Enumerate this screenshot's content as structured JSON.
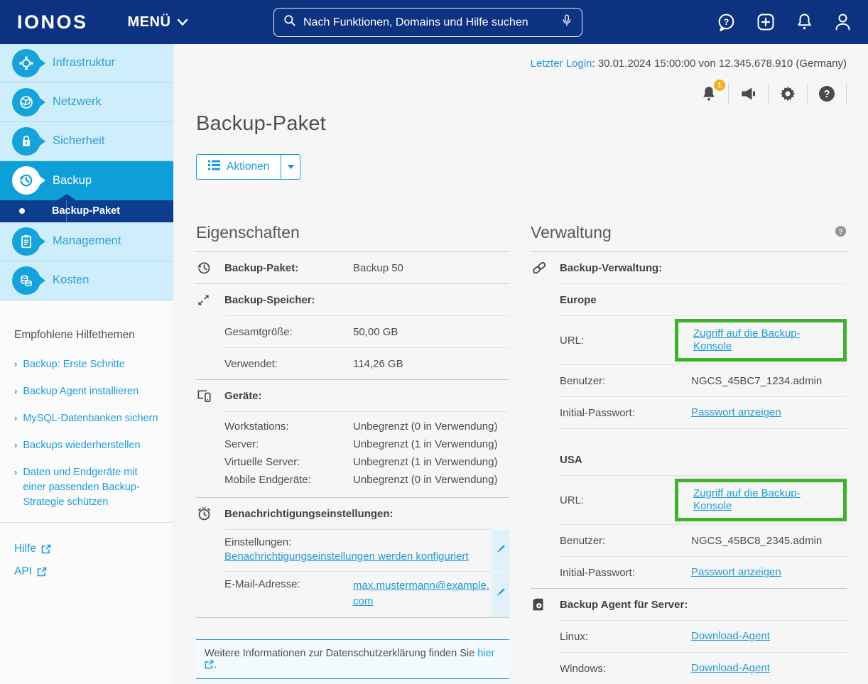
{
  "colors": {
    "accent_blue": "#1d9bd7",
    "header_navy": "#0d3380",
    "sidebar_blue": "#16a3db",
    "active_item_blue": "#0f9fd8",
    "subitem_navy": "#0d3d8e",
    "highlight_green": "#3cb32a",
    "badge_yellow": "#f2b21d"
  },
  "header": {
    "logo": "IONOS",
    "menu_label": "MENÜ",
    "search_placeholder": "Nach Funktionen, Domains und Hilfe suchen"
  },
  "sidebar": {
    "items": [
      {
        "label": "Infrastruktur"
      },
      {
        "label": "Netzwerk"
      },
      {
        "label": "Sicherheit"
      },
      {
        "label": "Backup"
      },
      {
        "label": "Management"
      },
      {
        "label": "Kosten"
      }
    ],
    "active_item": "Backup",
    "subitem": {
      "label": "Backup-Paket"
    },
    "help_section": {
      "title": "Empfohlene Hilfethemen",
      "links": [
        "Backup: Erste Schritte",
        "Backup Agent installieren",
        "MySQL-Datenbanken sichern",
        "Backups wiederherstellen",
        "Daten und Endgeräte mit einer passenden Backup-Strategie schützen"
      ]
    },
    "footer_links": [
      {
        "label": "Hilfe"
      },
      {
        "label": "API"
      }
    ]
  },
  "topbar": {
    "last_login_label": "Letzter Login",
    "last_login_value": ": 30.01.2024 15:00:00 von 12.345.678.910 (Germany)",
    "notification_badge": "1"
  },
  "page": {
    "title": "Backup-Paket",
    "actions_button": "Aktionen"
  },
  "eigenschaften": {
    "title": "Eigenschaften",
    "backup_paket_label": "Backup-Paket:",
    "backup_paket_value": "Backup 50",
    "backup_speicher_label": "Backup-Speicher:",
    "gesamtgroesse_label": "Gesamtgröße:",
    "gesamtgroesse_value": "50,00 GB",
    "verwendet_label": "Verwendet:",
    "verwendet_value": "114,26 GB",
    "geraete_label": "Geräte:",
    "geraete_rows": [
      {
        "label": "Workstations:",
        "value": "Unbegrenzt (0 in Verwendung)"
      },
      {
        "label": "Server:",
        "value": "Unbegrenzt (1 in Verwendung)"
      },
      {
        "label": "Virtuelle Server:",
        "value": "Unbegrenzt (1 in Verwendung)"
      },
      {
        "label": "Mobile Endgeräte:",
        "value": "Unbegrenzt (0 in Verwendung)"
      }
    ],
    "benachrichtigung_label": "Benachrichtigungseinstellungen:",
    "einstellungen_label": "Einstellungen:",
    "einstellungen_link": "Benachrichtigungseinstellungen werden konfiguriert",
    "email_label": "E-Mail-Adresse:",
    "email_link": "max.mustermann@example.com"
  },
  "infobox": {
    "text": "Weitere Informationen zur Datenschutzerklärung finden Sie",
    "link": "hier",
    "suffix": "."
  },
  "verwaltung": {
    "title": "Verwaltung",
    "backup_verwaltung_label": "Backup-Verwaltung:",
    "regions": [
      {
        "name": "Europe",
        "url_label": "URL:",
        "url_link": "Zugriff auf die Backup-Konsole",
        "benutzer_label": "Benutzer:",
        "benutzer_value": "NGCS_45BC7_1234.admin",
        "passwort_label": "Initial-Passwort:",
        "passwort_link": "Passwort anzeigen"
      },
      {
        "name": "USA",
        "url_label": "URL:",
        "url_link": "Zugriff auf die Backup-Konsole",
        "benutzer_label": "Benutzer:",
        "benutzer_value": "NGCS_45BC8_2345.admin",
        "passwort_label": "Initial-Passwort:",
        "passwort_link": "Passwort anzeigen"
      }
    ],
    "agent_label": "Backup Agent für Server:",
    "agent_rows": [
      {
        "label": "Linux:",
        "link": "Download-Agent"
      },
      {
        "label": "Windows:",
        "link": "Download-Agent"
      }
    ]
  }
}
